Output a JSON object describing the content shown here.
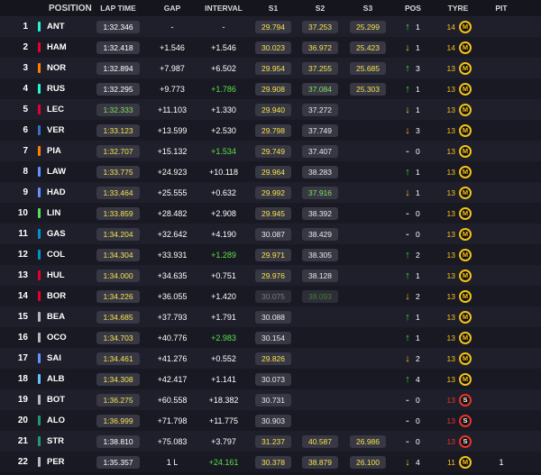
{
  "headers": {
    "position": "POSITION",
    "lap_time": "LAP TIME",
    "gap": "GAP",
    "interval": "INTERVAL",
    "s1": "S1",
    "s2": "S2",
    "s3": "S3",
    "pos": "POS",
    "tyre": "TYRE",
    "pit": "PIT"
  },
  "rows": [
    {
      "pos": "1",
      "driver": "ANT",
      "team_color": "#27f4d2",
      "lap": "1:32.346",
      "lap_color": "white",
      "gap": "-",
      "interval": "-",
      "interval_color": "white",
      "s1": "29.794",
      "s1c": "yellow",
      "s2": "37.253",
      "s2c": "yellow",
      "s3": "25.299",
      "s3c": "yellow",
      "arrow": "↑",
      "arrow_dir": "up",
      "poschange": "1",
      "tyre_age": "14",
      "tyre": "M",
      "tyre_type": "medium",
      "pit": ""
    },
    {
      "pos": "2",
      "driver": "HAM",
      "team_color": "#e8002d",
      "lap": "1:32.418",
      "lap_color": "white",
      "gap": "+1.546",
      "interval": "+1.546",
      "interval_color": "white",
      "s1": "30.023",
      "s1c": "yellow",
      "s2": "36.972",
      "s2c": "yellow",
      "s3": "25.423",
      "s3c": "yellow",
      "arrow": "↓",
      "arrow_dir": "down",
      "poschange": "1",
      "tyre_age": "14",
      "tyre": "M",
      "tyre_type": "medium",
      "pit": ""
    },
    {
      "pos": "3",
      "driver": "NOR",
      "team_color": "#ff8000",
      "lap": "1:32.894",
      "lap_color": "white",
      "gap": "+7.987",
      "interval": "+6.502",
      "interval_color": "white",
      "s1": "29.954",
      "s1c": "yellow",
      "s2": "37.255",
      "s2c": "yellow",
      "s3": "25.685",
      "s3c": "yellow",
      "arrow": "↑",
      "arrow_dir": "up",
      "poschange": "3",
      "tyre_age": "13",
      "tyre": "M",
      "tyre_type": "medium",
      "pit": ""
    },
    {
      "pos": "4",
      "driver": "RUS",
      "team_color": "#27f4d2",
      "lap": "1:32.295",
      "lap_color": "white",
      "gap": "+9.773",
      "interval": "+1.786",
      "interval_color": "green",
      "s1": "29.908",
      "s1c": "yellow",
      "s2": "37.084",
      "s2c": "green",
      "s3": "25.303",
      "s3c": "yellow",
      "arrow": "↑",
      "arrow_dir": "up",
      "poschange": "1",
      "tyre_age": "13",
      "tyre": "M",
      "tyre_type": "medium",
      "pit": ""
    },
    {
      "pos": "5",
      "driver": "LEC",
      "team_color": "#e8002d",
      "lap": "1:32.333",
      "lap_color": "green",
      "gap": "+11.103",
      "interval": "+1.330",
      "interval_color": "white",
      "s1": "29.940",
      "s1c": "yellow",
      "s2": "37.272",
      "s2c": "white",
      "s3": "",
      "s3c": "empty",
      "arrow": "↓",
      "arrow_dir": "down",
      "poschange": "1",
      "tyre_age": "13",
      "tyre": "M",
      "tyre_type": "medium",
      "pit": ""
    },
    {
      "pos": "6",
      "driver": "VER",
      "team_color": "#3671c6",
      "lap": "1:33.123",
      "lap_color": "yellow",
      "gap": "+13.599",
      "interval": "+2.530",
      "interval_color": "white",
      "s1": "29.798",
      "s1c": "yellow",
      "s2": "37.749",
      "s2c": "white",
      "s3": "",
      "s3c": "empty",
      "arrow": "↓",
      "arrow_dir": "down",
      "poschange": "3",
      "tyre_age": "13",
      "tyre": "M",
      "tyre_type": "medium",
      "pit": ""
    },
    {
      "pos": "7",
      "driver": "PIA",
      "team_color": "#ff8000",
      "lap": "1:32.707",
      "lap_color": "yellow",
      "gap": "+15.132",
      "interval": "+1.534",
      "interval_color": "green",
      "s1": "29.749",
      "s1c": "yellow",
      "s2": "37.407",
      "s2c": "white",
      "s3": "",
      "s3c": "empty",
      "arrow": "-",
      "arrow_dir": "same",
      "poschange": "0",
      "tyre_age": "13",
      "tyre": "M",
      "tyre_type": "medium",
      "pit": ""
    },
    {
      "pos": "8",
      "driver": "LAW",
      "team_color": "#6692ff",
      "lap": "1:33.775",
      "lap_color": "yellow",
      "gap": "+24.923",
      "interval": "+10.118",
      "interval_color": "white",
      "s1": "29.964",
      "s1c": "yellow",
      "s2": "38.283",
      "s2c": "white",
      "s3": "",
      "s3c": "empty",
      "arrow": "↑",
      "arrow_dir": "up",
      "poschange": "1",
      "tyre_age": "13",
      "tyre": "M",
      "tyre_type": "medium",
      "pit": ""
    },
    {
      "pos": "9",
      "driver": "HAD",
      "team_color": "#6692ff",
      "lap": "1:33.464",
      "lap_color": "yellow",
      "gap": "+25.555",
      "interval": "+0.632",
      "interval_color": "white",
      "s1": "29.992",
      "s1c": "yellow",
      "s2": "37.916",
      "s2c": "green",
      "s3": "",
      "s3c": "empty",
      "arrow": "↓",
      "arrow_dir": "down",
      "poschange": "1",
      "tyre_age": "13",
      "tyre": "M",
      "tyre_type": "medium",
      "pit": ""
    },
    {
      "pos": "10",
      "driver": "LIN",
      "team_color": "#52e252",
      "lap": "1:33.859",
      "lap_color": "yellow",
      "gap": "+28.482",
      "interval": "+2.908",
      "interval_color": "white",
      "s1": "29.945",
      "s1c": "yellow",
      "s2": "38.392",
      "s2c": "white",
      "s3": "",
      "s3c": "empty",
      "arrow": "-",
      "arrow_dir": "same",
      "poschange": "0",
      "tyre_age": "13",
      "tyre": "M",
      "tyre_type": "medium",
      "pit": ""
    },
    {
      "pos": "11",
      "driver": "GAS",
      "team_color": "#0093cc",
      "lap": "1:34.204",
      "lap_color": "yellow",
      "gap": "+32.642",
      "interval": "+4.190",
      "interval_color": "white",
      "s1": "30.087",
      "s1c": "white",
      "s2": "38.429",
      "s2c": "white",
      "s3": "",
      "s3c": "empty",
      "arrow": "-",
      "arrow_dir": "same",
      "poschange": "0",
      "tyre_age": "13",
      "tyre": "M",
      "tyre_type": "medium",
      "pit": ""
    },
    {
      "pos": "12",
      "driver": "COL",
      "team_color": "#0093cc",
      "lap": "1:34.304",
      "lap_color": "yellow",
      "gap": "+33.931",
      "interval": "+1.289",
      "interval_color": "green",
      "s1": "29.971",
      "s1c": "yellow",
      "s2": "38.305",
      "s2c": "white",
      "s3": "",
      "s3c": "empty",
      "arrow": "↑",
      "arrow_dir": "up",
      "poschange": "2",
      "tyre_age": "13",
      "tyre": "M",
      "tyre_type": "medium",
      "pit": ""
    },
    {
      "pos": "13",
      "driver": "HUL",
      "team_color": "#e8002d",
      "lap": "1:34.000",
      "lap_color": "yellow",
      "gap": "+34.635",
      "interval": "+0.751",
      "interval_color": "white",
      "s1": "29.976",
      "s1c": "yellow",
      "s2": "38.128",
      "s2c": "white",
      "s3": "",
      "s3c": "empty",
      "arrow": "↑",
      "arrow_dir": "up",
      "poschange": "1",
      "tyre_age": "13",
      "tyre": "M",
      "tyre_type": "medium",
      "pit": ""
    },
    {
      "pos": "14",
      "driver": "BOR",
      "team_color": "#e8002d",
      "lap": "1:34.226",
      "lap_color": "yellow",
      "gap": "+36.055",
      "interval": "+1.420",
      "interval_color": "white",
      "s1": "30.075",
      "s1c": "dim",
      "s2": "38.093",
      "s2c": "dimgreen",
      "s3": "",
      "s3c": "empty",
      "arrow": "↓",
      "arrow_dir": "down",
      "poschange": "2",
      "tyre_age": "13",
      "tyre": "M",
      "tyre_type": "medium",
      "pit": ""
    },
    {
      "pos": "15",
      "driver": "BEA",
      "team_color": "#b6babd",
      "lap": "1:34.685",
      "lap_color": "yellow",
      "gap": "+37.793",
      "interval": "+1.791",
      "interval_color": "white",
      "s1": "30.088",
      "s1c": "white",
      "s2": "",
      "s2c": "empty",
      "s3": "",
      "s3c": "empty",
      "arrow": "↑",
      "arrow_dir": "up",
      "poschange": "1",
      "tyre_age": "13",
      "tyre": "M",
      "tyre_type": "medium",
      "pit": ""
    },
    {
      "pos": "16",
      "driver": "OCO",
      "team_color": "#b6babd",
      "lap": "1:34.703",
      "lap_color": "yellow",
      "gap": "+40.776",
      "interval": "+2.983",
      "interval_color": "green",
      "s1": "30.154",
      "s1c": "white",
      "s2": "",
      "s2c": "empty",
      "s3": "",
      "s3c": "empty",
      "arrow": "↑",
      "arrow_dir": "up",
      "poschange": "1",
      "tyre_age": "13",
      "tyre": "M",
      "tyre_type": "medium",
      "pit": ""
    },
    {
      "pos": "17",
      "driver": "SAI",
      "team_color": "#6692ff",
      "lap": "1:34.461",
      "lap_color": "yellow",
      "gap": "+41.276",
      "interval": "+0.552",
      "interval_color": "white",
      "s1": "29.826",
      "s1c": "yellow",
      "s2": "",
      "s2c": "empty",
      "s3": "",
      "s3c": "empty",
      "arrow": "↓",
      "arrow_dir": "down",
      "poschange": "2",
      "tyre_age": "13",
      "tyre": "M",
      "tyre_type": "medium",
      "pit": ""
    },
    {
      "pos": "18",
      "driver": "ALB",
      "team_color": "#64c4ff",
      "lap": "1:34.308",
      "lap_color": "yellow",
      "gap": "+42.417",
      "interval": "+1.141",
      "interval_color": "white",
      "s1": "30.073",
      "s1c": "white",
      "s2": "",
      "s2c": "empty",
      "s3": "",
      "s3c": "empty",
      "arrow": "↑",
      "arrow_dir": "up",
      "poschange": "4",
      "tyre_age": "13",
      "tyre": "M",
      "tyre_type": "medium",
      "pit": ""
    },
    {
      "pos": "19",
      "driver": "BOT",
      "team_color": "#b6babd",
      "lap": "1:36.275",
      "lap_color": "yellow",
      "gap": "+60.558",
      "interval": "+18.382",
      "interval_color": "white",
      "s1": "30.731",
      "s1c": "white",
      "s2": "",
      "s2c": "empty",
      "s3": "",
      "s3c": "empty",
      "arrow": "-",
      "arrow_dir": "same",
      "poschange": "0",
      "tyre_age": "13",
      "tyre": "S",
      "tyre_type": "soft",
      "pit": ""
    },
    {
      "pos": "20",
      "driver": "ALO",
      "team_color": "#229971",
      "lap": "1:36.999",
      "lap_color": "yellow",
      "gap": "+71.798",
      "interval": "+11.775",
      "interval_color": "white",
      "s1": "30.903",
      "s1c": "white",
      "s2": "",
      "s2c": "empty",
      "s3": "",
      "s3c": "empty",
      "arrow": "-",
      "arrow_dir": "same",
      "poschange": "0",
      "tyre_age": "13",
      "tyre": "S",
      "tyre_type": "soft",
      "pit": ""
    },
    {
      "pos": "21",
      "driver": "STR",
      "team_color": "#229971",
      "lap": "1:38.810",
      "lap_color": "white",
      "gap": "+75.083",
      "interval": "+3.797",
      "interval_color": "white",
      "s1": "31.237",
      "s1c": "yellow",
      "s2": "40.587",
      "s2c": "yellow",
      "s3": "26.986",
      "s3c": "yellow",
      "arrow": "-",
      "arrow_dir": "same",
      "poschange": "0",
      "tyre_age": "13",
      "tyre": "S",
      "tyre_type": "soft",
      "pit": ""
    },
    {
      "pos": "22",
      "driver": "PER",
      "team_color": "#b6babd",
      "lap": "1:35.357",
      "lap_color": "white",
      "gap": "1 L",
      "interval": "+24.161",
      "interval_color": "green",
      "s1": "30.378",
      "s1c": "yellow",
      "s2": "38.879",
      "s2c": "yellow",
      "s3": "26.100",
      "s3c": "yellow",
      "arrow": "↓",
      "arrow_dir": "down",
      "poschange": "4",
      "tyre_age": "11",
      "tyre": "M",
      "tyre_type": "medium",
      "pit": "1"
    }
  ]
}
